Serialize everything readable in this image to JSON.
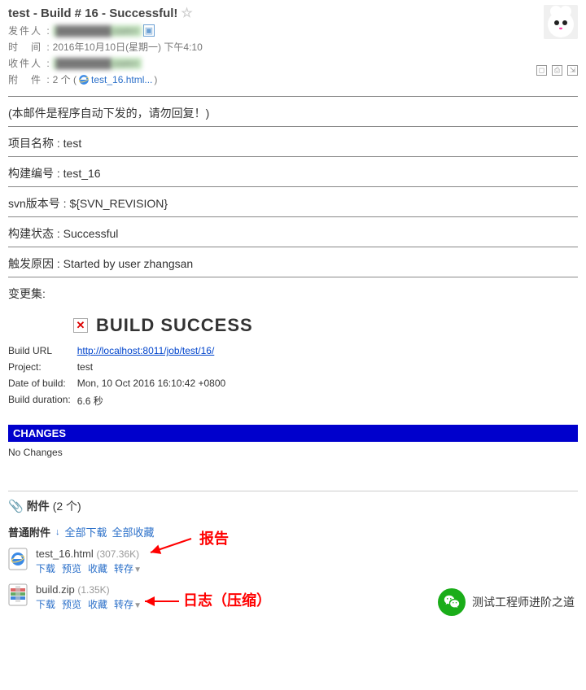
{
  "header": {
    "subject": "test - Build # 16 - Successful!",
    "from_label": "发件人 :",
    "from_value": "████████.com>",
    "time_label": "时　间 :",
    "time_value": "2016年10月10日(星期一) 下午4:10",
    "to_label": "收件人 :",
    "to_value": "████████.com>",
    "att_label": "附　件 :",
    "att_count": "2 个 (",
    "att_name": "test_16.html...",
    "att_close": ")"
  },
  "body": {
    "auto_notice": "(本邮件是程序自动下发的，请勿回复！)",
    "project_name": "项目名称 : test",
    "build_number": "构建编号 : test_16",
    "svn_rev": "svn版本号 : ${SVN_REVISION}",
    "status": "构建状态 : Successful",
    "trigger": "触发原因 : Started by user zhangsan",
    "changeset": "变更集:"
  },
  "build": {
    "title": "BUILD SUCCESS",
    "rows": {
      "url_label": "Build URL",
      "url_value": "http://localhost:8011/job/test/16/",
      "project_label": "Project:",
      "project_value": "test",
      "date_label": "Date of build:",
      "date_value": "Mon, 10 Oct 2016 16:10:42 +0800",
      "duration_label": "Build duration:",
      "duration_value": "6.6 秒"
    },
    "changes_header": "CHANGES",
    "no_changes": "No Changes"
  },
  "attachments": {
    "title": "附件",
    "count": "(2 个)",
    "normal_label": "普通附件",
    "download_all": "全部下载",
    "fav_all": "全部收藏",
    "files": [
      {
        "name": "test_16.html",
        "size": "(307.36K)"
      },
      {
        "name": "build.zip",
        "size": "(1.35K)"
      }
    ],
    "actions": {
      "download": "下载",
      "preview": "预览",
      "fav": "收藏",
      "save": "转存"
    }
  },
  "annotations": {
    "report": "报告",
    "log": "日志（压缩）"
  },
  "footer": {
    "text": "测试工程师进阶之道"
  }
}
